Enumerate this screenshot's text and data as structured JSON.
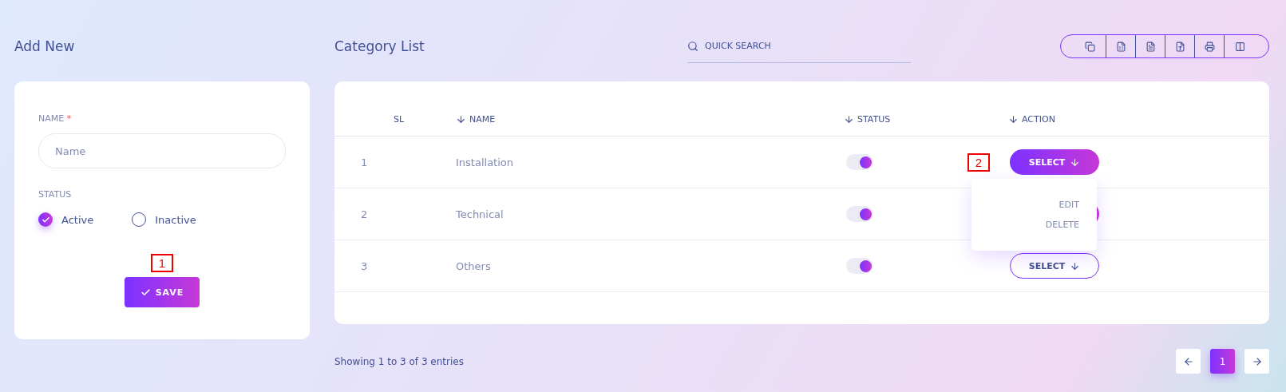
{
  "add_form": {
    "title": "Add New",
    "name_label": "NAME",
    "required_mark": "*",
    "name_placeholder": "Name",
    "status_label": "STATUS",
    "status_options": [
      {
        "label": "Active",
        "selected": true
      },
      {
        "label": "Inactive",
        "selected": false
      }
    ],
    "callout": "1",
    "save_label": "SAVE"
  },
  "category_list": {
    "title": "Category List",
    "search_placeholder": "QUICK SEARCH",
    "export_buttons": [
      {
        "kind": "copy"
      },
      {
        "kind": "excel"
      },
      {
        "kind": "csv"
      },
      {
        "kind": "pdf"
      },
      {
        "kind": "print"
      },
      {
        "kind": "columns"
      }
    ],
    "columns": [
      {
        "label": "SL",
        "sortable": false
      },
      {
        "label": "NAME",
        "sortable": true
      },
      {
        "label": "STATUS",
        "sortable": true
      },
      {
        "label": "ACTION",
        "sortable": true
      }
    ],
    "rows": [
      {
        "sl": "1",
        "name": "Installation",
        "on": true,
        "select": {
          "label": "SELECT",
          "filled": true,
          "expanded": true,
          "callout": "2",
          "menu": [
            "EDIT",
            "DELETE"
          ]
        }
      },
      {
        "sl": "2",
        "name": "Technical",
        "on": true,
        "select": {
          "filled": true,
          "expanded": false
        }
      },
      {
        "sl": "3",
        "name": "Others",
        "on": true,
        "select": {
          "label": "SELECT",
          "filled": false,
          "expanded": false
        }
      }
    ],
    "footer": "Showing 1 to 3 of 3 entries",
    "pages": [
      {
        "label": "1",
        "selected": true
      }
    ]
  }
}
